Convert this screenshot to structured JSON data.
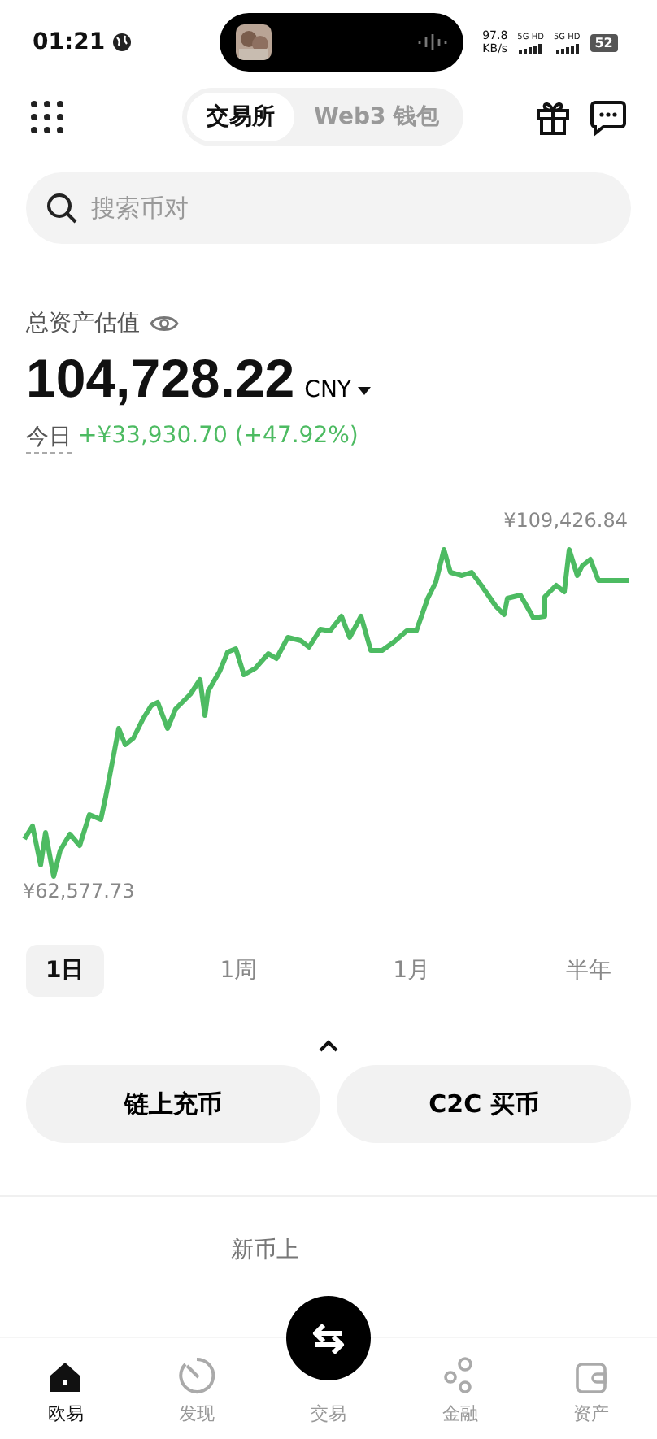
{
  "status_bar": {
    "time": "01:21",
    "net_speed": "97.8",
    "net_unit": "KB/s",
    "signals": [
      "5G HD",
      "5G HD"
    ],
    "battery": "52"
  },
  "header": {
    "tabs": [
      {
        "label": "交易所",
        "selected": true
      },
      {
        "label": "Web3 钱包",
        "selected": false
      }
    ]
  },
  "search": {
    "placeholder": "搜索币对"
  },
  "assets": {
    "label": "总资产估值",
    "value": "104,728.22",
    "currency": "CNY",
    "today_label": "今日",
    "today_change": "+¥33,930.70 (+47.92%)"
  },
  "chart": {
    "max_label": "¥109,426.84",
    "min_label": "¥62,577.73"
  },
  "periods": [
    {
      "label": "1日",
      "selected": true
    },
    {
      "label": "1周",
      "selected": false
    },
    {
      "label": "1月",
      "selected": false
    },
    {
      "label": "半年",
      "selected": false
    }
  ],
  "actions": [
    "链上充币",
    "C2C 买币"
  ],
  "section_peek": "新币上",
  "nav": [
    {
      "label": "欧易",
      "kind": "home",
      "selected": true
    },
    {
      "label": "发现",
      "kind": "discover",
      "selected": false
    },
    {
      "label": "交易",
      "kind": "swap",
      "selected": false
    },
    {
      "label": "金融",
      "kind": "finance",
      "selected": false
    },
    {
      "label": "资产",
      "kind": "wallet",
      "selected": false
    }
  ]
}
